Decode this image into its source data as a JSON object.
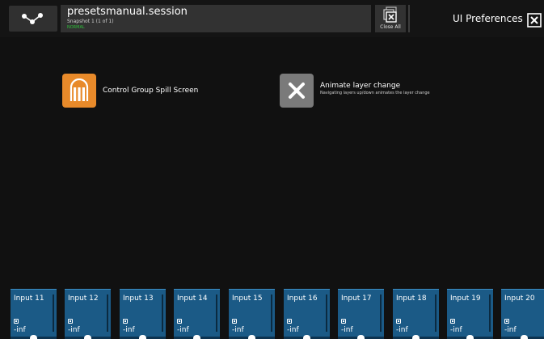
{
  "session": {
    "name": "presetsmanual.session",
    "snapshot": "Snapshot 1 (1 of 1)",
    "status": "NORMAL"
  },
  "toolbar": {
    "close_all_label": "Close All"
  },
  "page": {
    "title": "UI Preferences"
  },
  "preferences": [
    {
      "label": "Control Group Spill Screen",
      "description": "",
      "icon": "control-group-icon",
      "icon_color": "#e88a2a"
    },
    {
      "label": "Animate layer change",
      "description": "Navigating layers up/down animates the layer change",
      "icon": "close-x-icon",
      "icon_color": "#7a7a7a"
    }
  ],
  "channels": [
    {
      "name": "Input 11",
      "level": "-inf"
    },
    {
      "name": "Input 12",
      "level": "-inf"
    },
    {
      "name": "Input 13",
      "level": "-inf"
    },
    {
      "name": "Input 14",
      "level": "-inf"
    },
    {
      "name": "Input 15",
      "level": "-inf"
    },
    {
      "name": "Input 16",
      "level": "-inf"
    },
    {
      "name": "Input 17",
      "level": "-inf"
    },
    {
      "name": "Input 18",
      "level": "-inf"
    },
    {
      "name": "Input 19",
      "level": "-inf"
    },
    {
      "name": "Input 20",
      "level": "-inf"
    }
  ],
  "colors": {
    "channel": "#1b5a86",
    "status_green": "#2fbf3a",
    "accent_orange": "#e88a2a"
  }
}
